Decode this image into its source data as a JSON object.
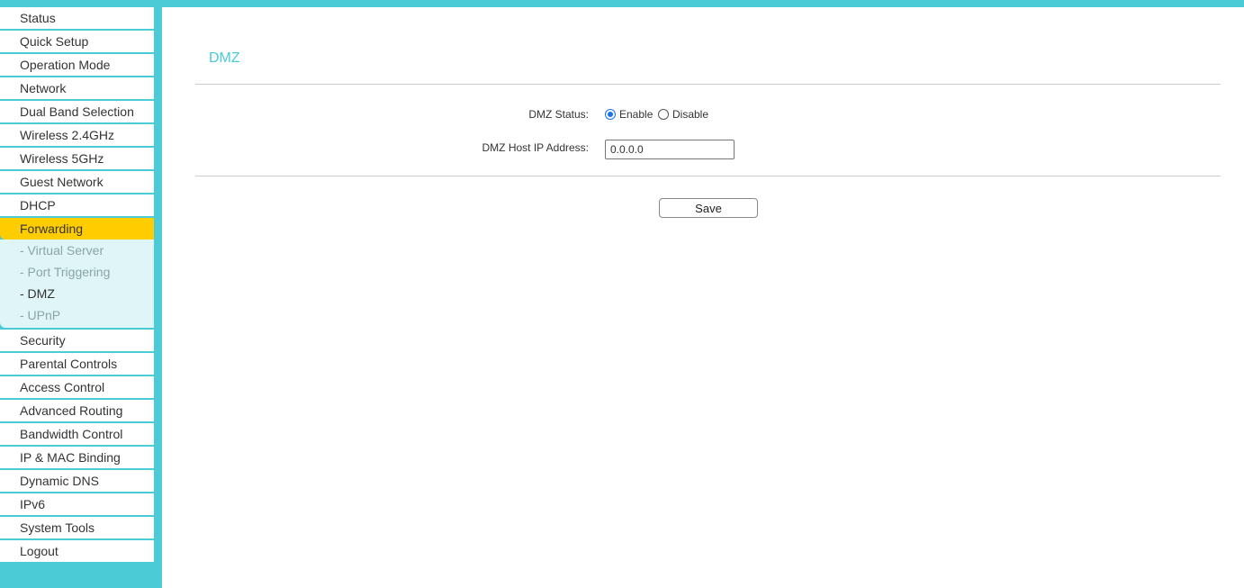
{
  "sidebar": {
    "items_top": [
      "Status",
      "Quick Setup",
      "Operation Mode",
      "Network",
      "Dual Band Selection",
      "Wireless 2.4GHz",
      "Wireless 5GHz",
      "Guest Network",
      "DHCP"
    ],
    "active": "Forwarding",
    "sub_items": [
      "- Virtual Server",
      "- Port Triggering",
      "- DMZ",
      "- UPnP"
    ],
    "items_bottom": [
      "Security",
      "Parental Controls",
      "Access Control",
      "Advanced Routing",
      "Bandwidth Control",
      "IP & MAC Binding",
      "Dynamic DNS",
      "IPv6",
      "System Tools",
      "Logout"
    ]
  },
  "page": {
    "title": "DMZ",
    "status_label": "DMZ Status:",
    "enable_label": "Enable",
    "disable_label": "Disable",
    "status_value": "Enable",
    "host_ip_label": "DMZ Host IP Address:",
    "host_ip_value": "0.0.0.0",
    "save_label": "Save"
  },
  "colors": {
    "accent": "#4acbd6",
    "active": "#ffcc00",
    "submenu_bg": "#e0f5f7"
  }
}
